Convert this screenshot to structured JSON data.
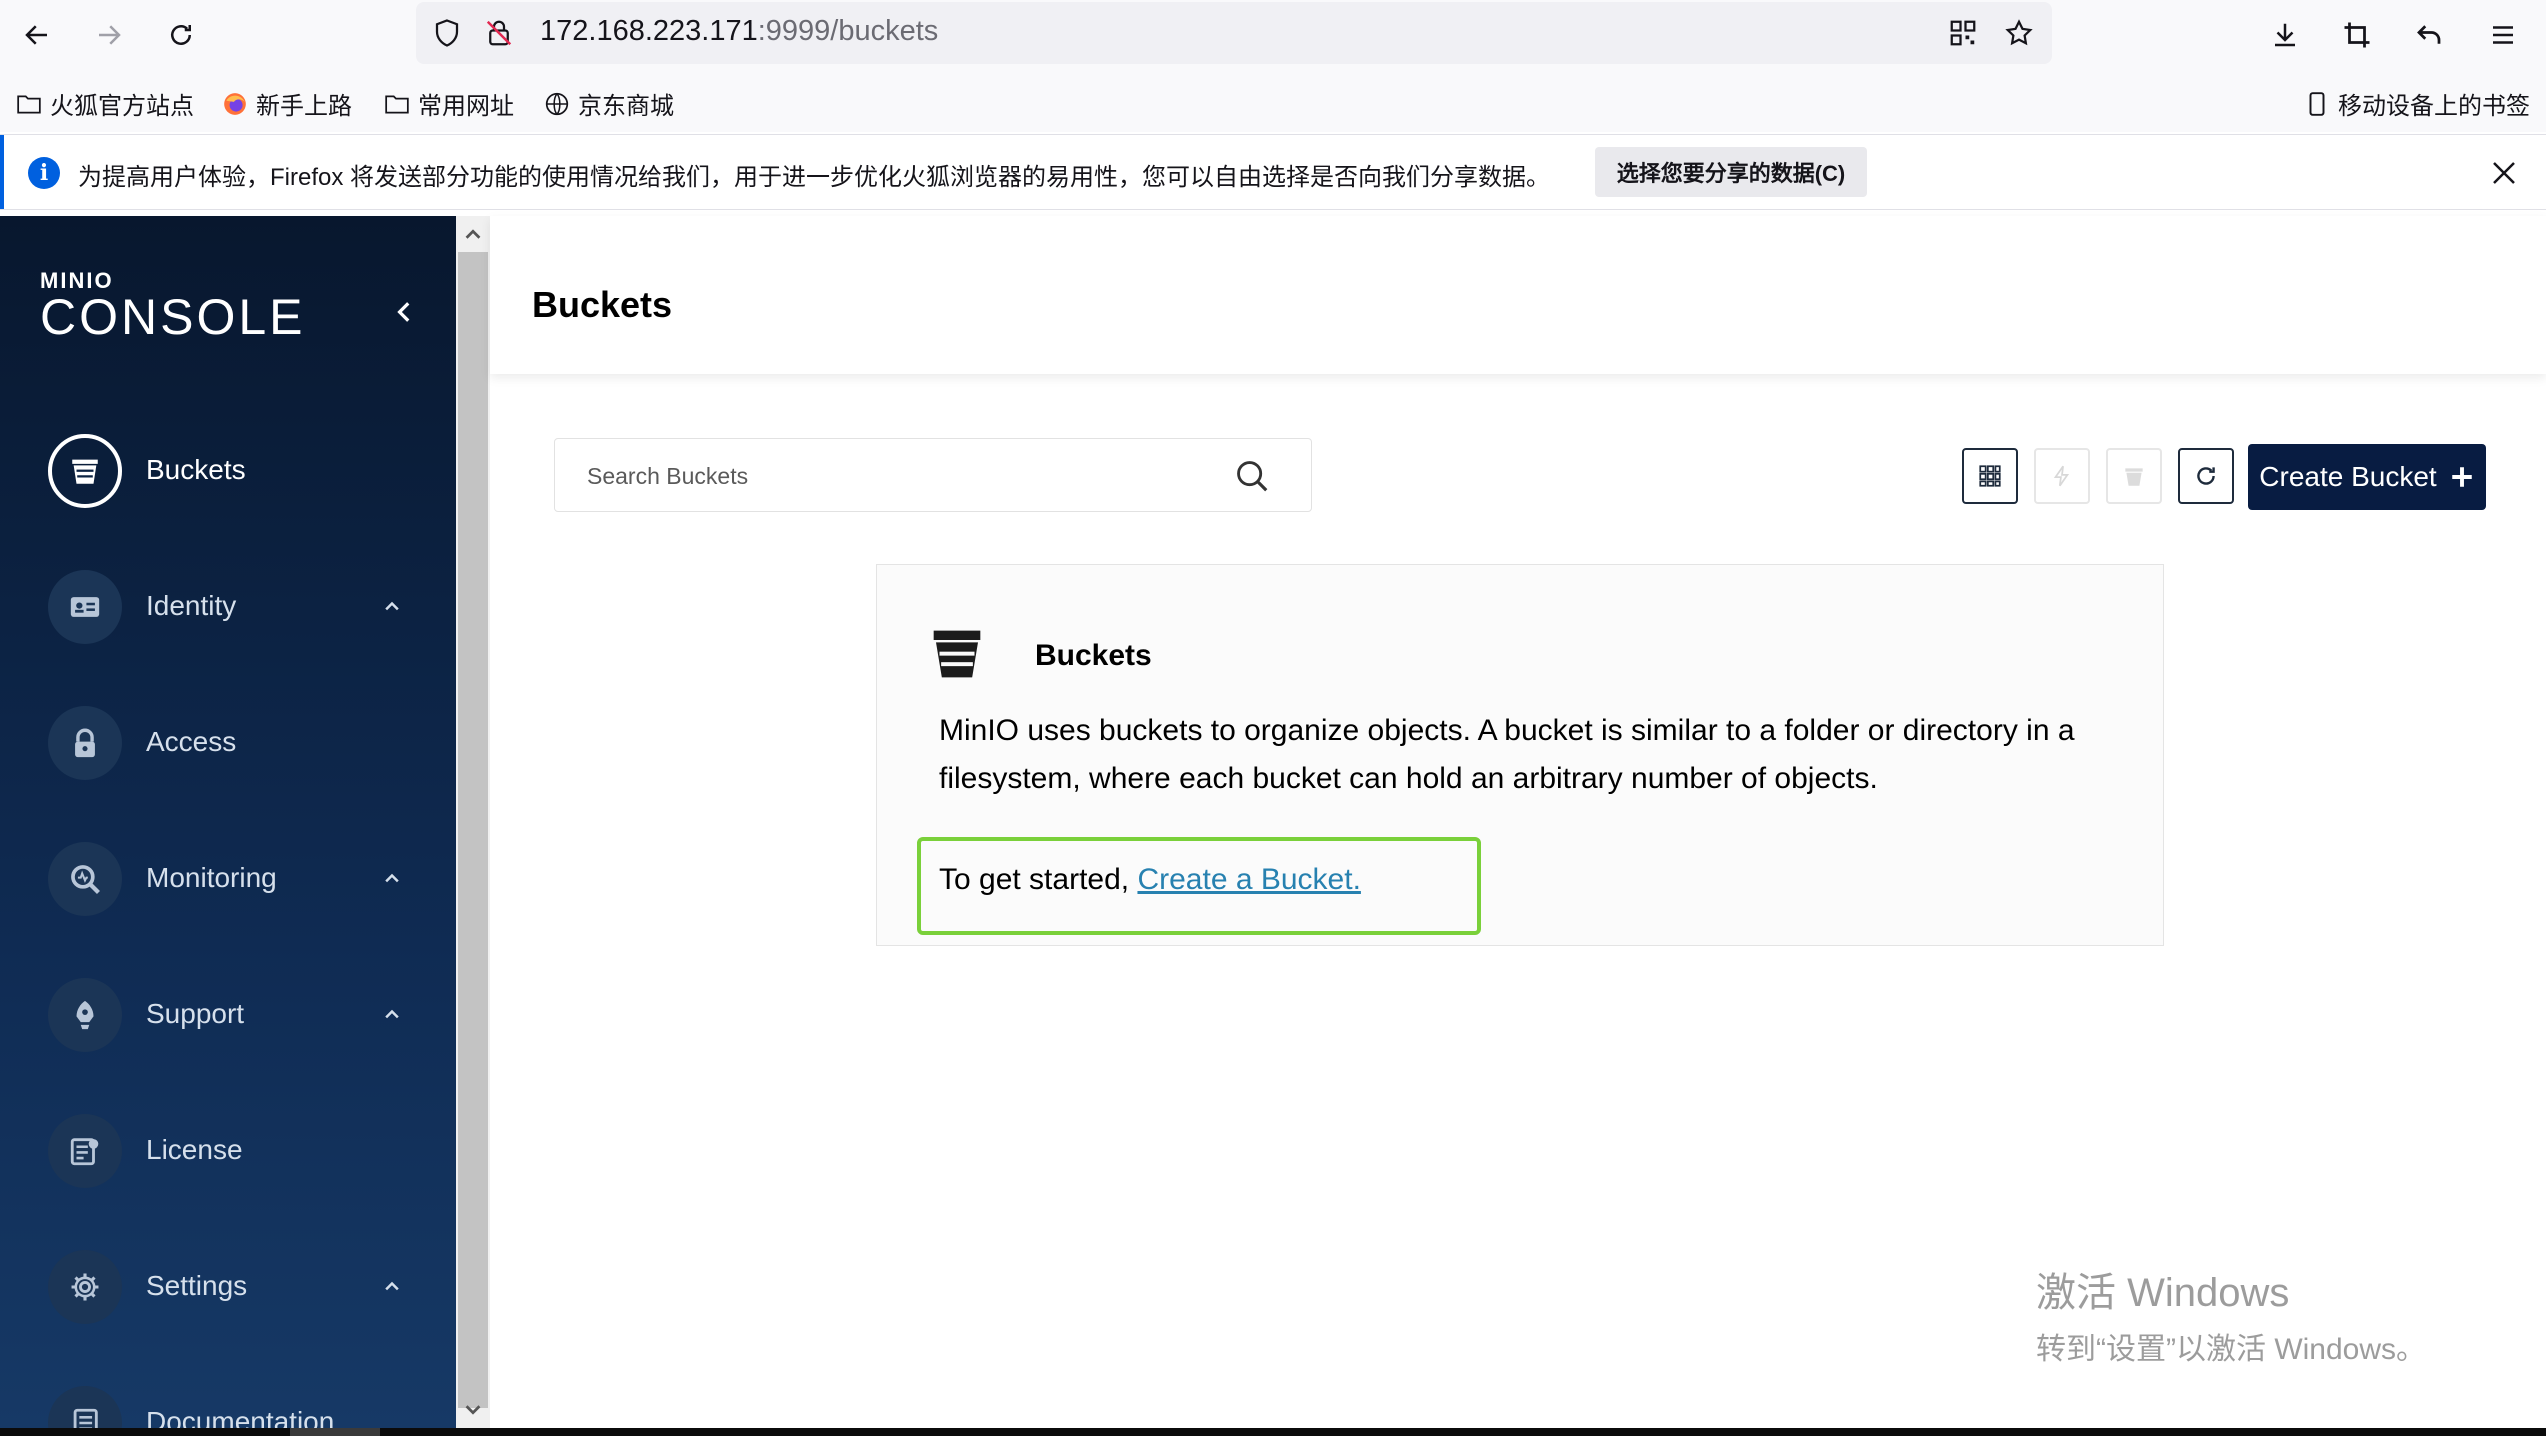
{
  "browser": {
    "url_host": "172.168.223.171",
    "url_path": ":9999/buckets",
    "bookmarks": [
      "火狐官方站点",
      "新手上路",
      "常用网址",
      "京东商城"
    ],
    "mobile_bookmarks": "移动设备上的书签",
    "notification": {
      "text": "为提高用户体验，Firefox 将发送部分功能的使用情况给我们，用于进一步优化火狐浏览器的易用性，您可以自由选择是否向我们分享数据。",
      "button": "选择您要分享的数据(C)"
    }
  },
  "sidebar": {
    "logo_small": "MINIO",
    "logo_big": "CONSOLE",
    "items": [
      {
        "label": "Buckets",
        "icon": "bucket-icon",
        "active": true
      },
      {
        "label": "Identity",
        "icon": "id-card-icon",
        "expandable": true
      },
      {
        "label": "Access",
        "icon": "lock-icon"
      },
      {
        "label": "Monitoring",
        "icon": "magnifier-icon",
        "expandable": true
      },
      {
        "label": "Support",
        "icon": "support-icon",
        "expandable": true
      },
      {
        "label": "License",
        "icon": "license-icon"
      },
      {
        "label": "Settings",
        "icon": "gear-icon",
        "expandable": true
      },
      {
        "label": "Documentation",
        "icon": "document-icon"
      }
    ]
  },
  "main": {
    "title": "Buckets",
    "search_placeholder": "Search Buckets",
    "create_button": "Create Bucket",
    "card": {
      "title": "Buckets",
      "description": "MinIO uses buckets to organize objects. A bucket is similar to a folder or directory in a filesystem, where each bucket can hold an arbitrary number of objects.",
      "cta_prefix": "To get started,",
      "cta_link": "Create a Bucket."
    }
  },
  "watermark": {
    "line1": "激活 Windows",
    "line2": "转到“设置”以激活 Windows。"
  }
}
